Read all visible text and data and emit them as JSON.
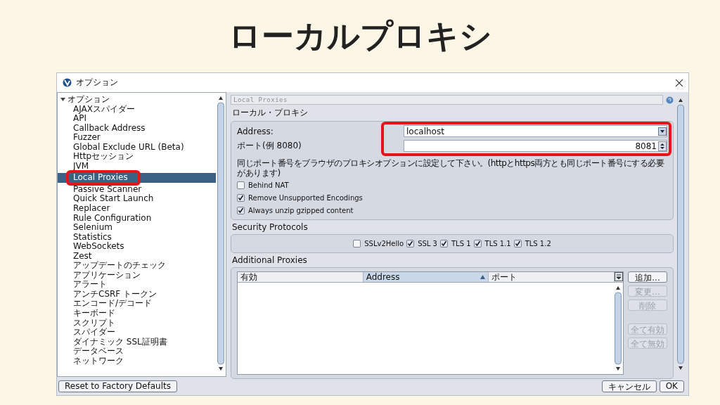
{
  "slide": {
    "title": "ローカルプロキシ"
  },
  "window": {
    "title": "オプション"
  },
  "tree": {
    "label": "オプション",
    "expanded": true,
    "children": [
      {
        "label": "AJAXスパイダー",
        "selected": false
      },
      {
        "label": "API",
        "selected": false
      },
      {
        "label": "Callback Address",
        "selected": false
      },
      {
        "label": "Fuzzer",
        "selected": false
      },
      {
        "label": "Global Exclude URL (Beta)",
        "selected": false
      },
      {
        "label": "Httpセッション",
        "selected": false
      },
      {
        "label": "JVM",
        "selected": false
      },
      {
        "label": "Local Proxies",
        "selected": true
      },
      {
        "label": "Passive Scanner",
        "selected": false
      },
      {
        "label": "Quick Start Launch",
        "selected": false
      },
      {
        "label": "Replacer",
        "selected": false
      },
      {
        "label": "Rule Configuration",
        "selected": false
      },
      {
        "label": "Selenium",
        "selected": false
      },
      {
        "label": "Statistics",
        "selected": false
      },
      {
        "label": "WebSockets",
        "selected": false
      },
      {
        "label": "Zest",
        "selected": false
      },
      {
        "label": "アップデートのチェック",
        "selected": false
      },
      {
        "label": "アプリケーション",
        "selected": false
      },
      {
        "label": "アラート",
        "selected": false
      },
      {
        "label": "アンチCSRF トークン",
        "selected": false
      },
      {
        "label": "エンコード/デコード",
        "selected": false
      },
      {
        "label": "キーボード",
        "selected": false
      },
      {
        "label": "スクリプト",
        "selected": false
      },
      {
        "label": "スパイダー",
        "selected": false
      },
      {
        "label": "ダイナミック SSL証明書",
        "selected": false
      },
      {
        "label": "データベース",
        "selected": false
      },
      {
        "label": "ネットワーク",
        "selected": false
      }
    ]
  },
  "panel": {
    "header": "Local Proxies",
    "section": "ローカル・プロキシ",
    "fields": [
      {
        "label": "Address:",
        "value": "localhost",
        "kind": "dropdown"
      },
      {
        "label": "ポート(例 8080)",
        "value": "8081",
        "kind": "spinner"
      }
    ],
    "note": "同じポート番号をブラウザのプロキシオプションに設定して下さい。(httpとhttps両方とも同じポート番号にする必要があります)",
    "options": [
      {
        "label": "Behind NAT",
        "checked": false
      },
      {
        "label": "Remove Unsupported Encodings",
        "checked": true
      },
      {
        "label": "Always unzip gzipped content",
        "checked": true
      }
    ]
  },
  "security": {
    "title": "Security Protocols",
    "protocols": [
      {
        "label": "SSLv2Hello",
        "checked": false
      },
      {
        "label": "SSL 3",
        "checked": true
      },
      {
        "label": "TLS 1",
        "checked": true
      },
      {
        "label": "TLS 1.1",
        "checked": true
      },
      {
        "label": "TLS 1.2",
        "checked": true
      }
    ]
  },
  "additional": {
    "title": "Additional Proxies",
    "columns": [
      {
        "label": "有効",
        "sorted": false
      },
      {
        "label": "Address",
        "sorted": true
      },
      {
        "label": "ポート",
        "sorted": false
      }
    ],
    "buttons": [
      {
        "label": "追加...",
        "disabled": false
      },
      {
        "label": "変更...",
        "disabled": true
      },
      {
        "label": "削除",
        "disabled": true
      },
      {
        "label": "全て有効",
        "disabled": true
      },
      {
        "label": "全て無効",
        "disabled": true
      }
    ]
  },
  "footer": {
    "reset": "Reset to Factory Defaults",
    "buttons": [
      "キャンセル",
      "OK"
    ]
  }
}
